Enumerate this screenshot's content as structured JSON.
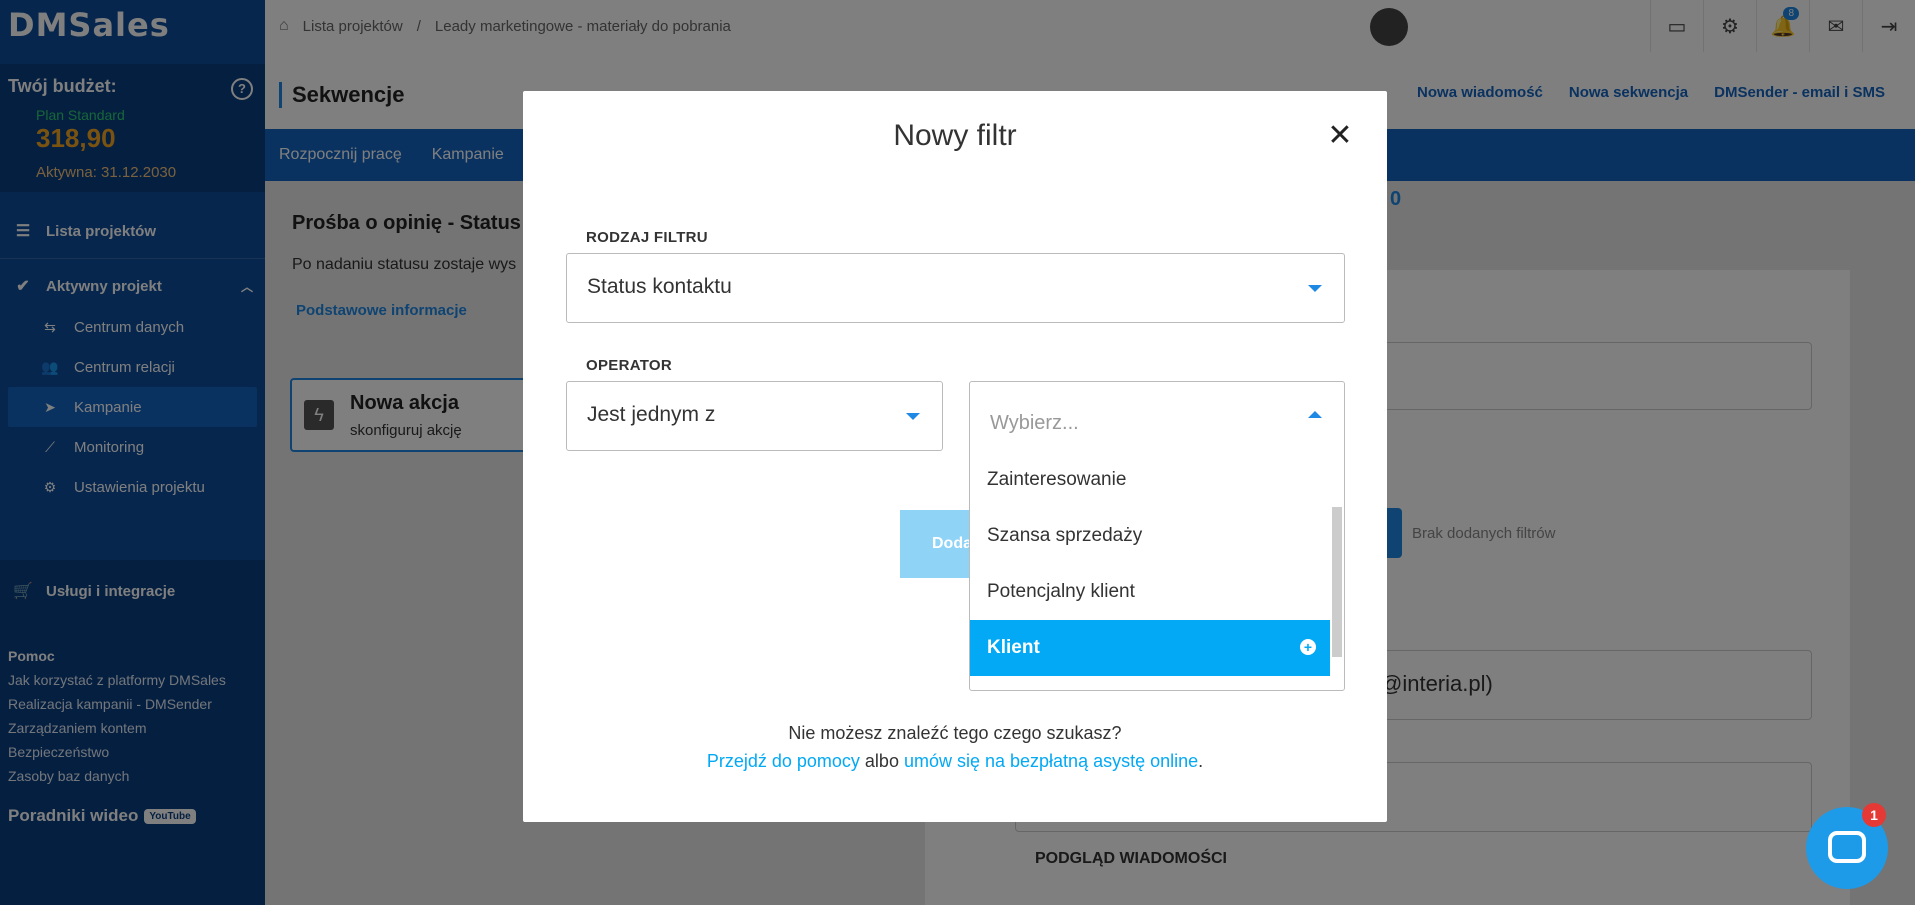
{
  "app": {
    "logo": "DMSales"
  },
  "sidebar": {
    "budget_title": "Twój budżet:",
    "plan": "Plan Standard",
    "amount": "318,90",
    "active_until": "Aktywna: 31.12.2030",
    "projects_list": "Lista projektów",
    "active_project": "Aktywny projekt",
    "sub_items": [
      "Centrum danych",
      "Centrum relacji",
      "Kampanie",
      "Monitoring",
      "Ustawienia projektu"
    ],
    "services": "Usługi i integracje",
    "help_title": "Pomoc",
    "help_links": [
      "Jak korzystać z platformy DMSales",
      "Realizacja kampanii - DMSender",
      "Zarządzaniem kontem",
      "Bezpieczeństwo",
      "Zasoby baz danych"
    ],
    "video": "Poradniki wideo",
    "youtube": "YouTube"
  },
  "topbar": {
    "breadcrumb_1": "Lista projektów",
    "breadcrumb_sep": "/",
    "breadcrumb_2": "Leady marketingowe - materiały do pobrania",
    "notifications_count": "8"
  },
  "page": {
    "title": "Sekwencje",
    "actions": [
      "Nowa wiadomość",
      "Nowa sekwencja",
      "DMSender - email i SMS"
    ],
    "tabs": [
      "Rozpocznij pracę",
      "Kampanie"
    ]
  },
  "content": {
    "title": "Prośba o opinię - Status",
    "desc": "Po nadaniu statusu zostaje wys",
    "info_link": "Podstawowe informacje",
    "card_title": "Nowa akcja",
    "card_sub": "skonfiguruj akcję",
    "zero": "0",
    "no_filters": "Brak dodanych filtrów",
    "email_tail": "@interia.pl)",
    "preview_label": "PODGLĄD WIADOMOŚCI"
  },
  "modal": {
    "title": "Nowy filtr",
    "close": "✕",
    "filter_type_label": "RODZAJ FILTRU",
    "filter_type_value": "Status kontaktu",
    "operator_label": "OPERATOR",
    "operator_value": "Jest jednym z",
    "select_placeholder": "Wybierz...",
    "options": [
      {
        "label": "Zainteresowanie",
        "selected": false
      },
      {
        "label": "Szansa sprzedaży",
        "selected": false
      },
      {
        "label": "Potencjalny klient",
        "selected": false
      },
      {
        "label": "Klient",
        "selected": true
      }
    ],
    "add_button": "Doda",
    "footer_question": "Nie możesz znaleźć tego czego szukasz?",
    "footer_link_1": "Przejdź do pomocy",
    "footer_or": "albo",
    "footer_link_2": "umów się na bezpłatną asystę online",
    "footer_end": "."
  },
  "chat": {
    "badge": "1"
  },
  "colors": {
    "accent": "#03a9f4",
    "sidebar": "#0d4d9a",
    "primary": "#1565c0"
  }
}
